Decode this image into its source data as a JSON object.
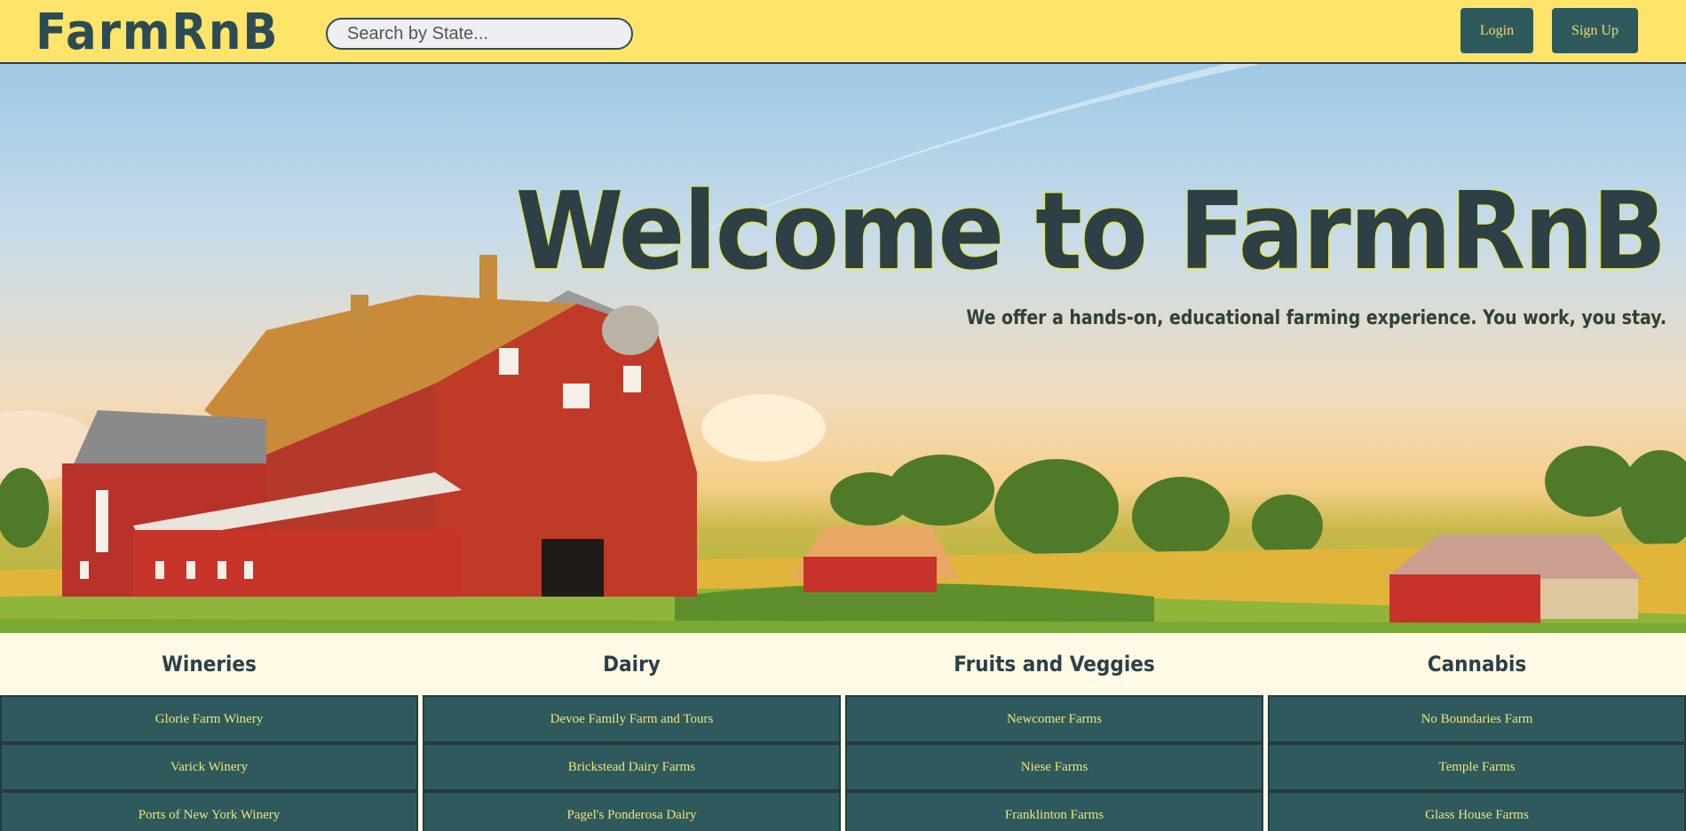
{
  "header": {
    "logo": "FarmRnB",
    "search_placeholder": "Search by State...",
    "login_label": "Login",
    "signup_label": "Sign Up"
  },
  "hero": {
    "title": "Welcome to FarmRnB",
    "subtitle": "We offer a hands-on, educational farming experience. You work, you stay."
  },
  "categories": [
    {
      "title": "Wineries",
      "farms": [
        "Glorie Farm Winery",
        "Varick Winery",
        "Ports of New York Winery"
      ]
    },
    {
      "title": "Dairy",
      "farms": [
        "Devoe Family Farm and Tours",
        "Brickstead Dairy Farms",
        "Pagel's Ponderosa Dairy"
      ]
    },
    {
      "title": "Fruits and Veggies",
      "farms": [
        "Newcomer Farms",
        "Niese Farms",
        "Franklinton Farms"
      ]
    },
    {
      "title": "Cannabis",
      "farms": [
        "No Boundaries Farm",
        "Temple Farms",
        "Glass House Farms"
      ]
    }
  ],
  "colors": {
    "header_bg": "#ffe46a",
    "accent": "#2e5a5e",
    "text_dark": "#2c4046",
    "button_text": "#f3d96b"
  }
}
